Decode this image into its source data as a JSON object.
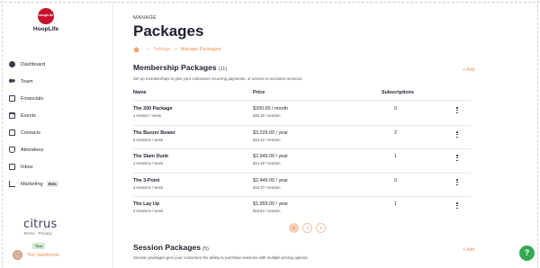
{
  "sidebar": {
    "logo_badge": "hoopLife",
    "logo_text": "HoopLife",
    "items": [
      {
        "label": "Dashboard",
        "icon": "dashboard-icon"
      },
      {
        "label": "Team",
        "icon": "team-icon"
      },
      {
        "label": "Financials",
        "icon": "financials-icon"
      },
      {
        "label": "Events",
        "icon": "events-icon"
      },
      {
        "label": "Contacts",
        "icon": "contacts-icon"
      },
      {
        "label": "Attendees",
        "icon": "attendees-icon"
      },
      {
        "label": "Inbox",
        "icon": "inbox-icon"
      },
      {
        "label": "Marketing",
        "icon": "marketing-icon",
        "badge": "Beta"
      }
    ],
    "brand": "citrus",
    "terms": "Terms",
    "privacy": "Privacy",
    "link_sep": "·",
    "env_badge": "Test",
    "user_name": "Tori Sambrook"
  },
  "header": {
    "eyebrow": "MANAGE",
    "title": "Packages",
    "breadcrumb": [
      "Settings",
      "Manage Packages"
    ]
  },
  "membership": {
    "title": "Membership Packages",
    "count": "(11)",
    "description": "Set up memberships to give your customers recurring payments, or access to exclusive services.",
    "add_label": "+ Add",
    "columns": [
      "Name",
      "Price",
      "Subscriptions"
    ],
    "rows": [
      {
        "name": "The 200 Package",
        "sub": "1 session / week",
        "price": "$200.00 / month",
        "price_sub": "$46.15 / session",
        "subs": "0"
      },
      {
        "name": "The Buzzer Beater",
        "sub": "5 sessions / week",
        "price": "$3,229.00 / year",
        "price_sub": "$12.42 / session",
        "subs": "2"
      },
      {
        "name": "The Slam Dunk",
        "sub": "4 sessions / week",
        "price": "$2,949.00 / year",
        "price_sub": "$14.18 / session",
        "subs": "1"
      },
      {
        "name": "The 3-Point",
        "sub": "3 sessions / week",
        "price": "$2,449.00 / year",
        "price_sub": "$15.70 / session",
        "subs": "0"
      },
      {
        "name": "The Lay Up",
        "sub": "2 sessions / week",
        "price": "$1,959.00 / year",
        "price_sub": "$18.84 / session",
        "subs": "1"
      }
    ],
    "pages": [
      "1",
      "2",
      "3"
    ],
    "active_page": "1"
  },
  "session": {
    "title": "Session Packages",
    "count": "(5)",
    "description": "Session packages give your customers the ability to purchase sessions with multiple pricing options.",
    "add_label": "+ Add"
  },
  "help": {
    "label": "?"
  },
  "colors": {
    "accent": "#f28c4b",
    "brand_red": "#c8102e",
    "help_green": "#34a853"
  }
}
